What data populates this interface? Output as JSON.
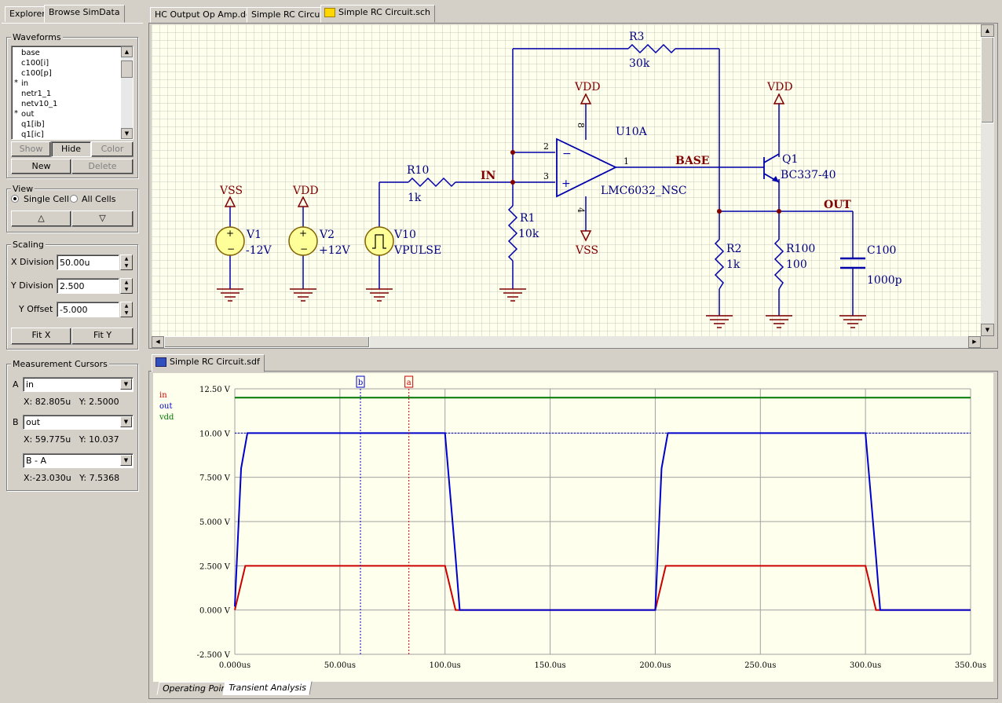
{
  "left_tabs": [
    "Explorer",
    "Browse SimData"
  ],
  "waveforms": {
    "title": "Waveforms",
    "items": [
      {
        "label": "base",
        "star": ""
      },
      {
        "label": "c100[i]",
        "star": ""
      },
      {
        "label": "c100[p]",
        "star": ""
      },
      {
        "label": "in",
        "star": "*"
      },
      {
        "label": "netr1_1",
        "star": ""
      },
      {
        "label": "netv10_1",
        "star": ""
      },
      {
        "label": "out",
        "star": "*"
      },
      {
        "label": "q1[ib]",
        "star": ""
      },
      {
        "label": "q1[ic]",
        "star": ""
      }
    ],
    "show_label": "Show",
    "hide_label": "Hide",
    "color_label": "Color",
    "new_label": "New",
    "delete_label": "Delete"
  },
  "view": {
    "title": "View",
    "single_cell": "Single Cell",
    "all_cells": "All Cells",
    "up_glyph": "△",
    "down_glyph": "▽"
  },
  "scaling": {
    "title": "Scaling",
    "x_label": "X Division",
    "x_value": "50.00u",
    "y_label": "Y Division",
    "y_value": "2.500",
    "offset_label": "Y Offset",
    "offset_value": "-5.000",
    "fit_x": "Fit X",
    "fit_y": "Fit Y"
  },
  "cursors": {
    "title": "Measurement Cursors",
    "a_label": "A",
    "a_value": "in",
    "a_readout": "X: 82.805u   Y: 2.5000",
    "b_label": "B",
    "b_value": "out",
    "b_readout": "X: 59.775u   Y: 10.037",
    "diff_value": "B - A",
    "diff_readout": "X:-23.030u   Y: 7.5368"
  },
  "doc_tabs": [
    "HC Output Op Amp.ddb",
    "Simple RC Circuit",
    "Simple RC Circuit.sch"
  ],
  "schematic": {
    "VSS_a": "VSS",
    "VDD_a": "VDD",
    "VDD_op": "VDD",
    "VSS_op": "VSS",
    "VDD_q": "VDD",
    "V1": "V1",
    "V1_val": "-12V",
    "V2": "V2",
    "V2_val": "+12V",
    "V10": "V10",
    "V10_val": "VPULSE",
    "R10": "R10",
    "R10_val": "1k",
    "R1": "R1",
    "R1_val": "10k",
    "R3": "R3",
    "R3_val": "30k",
    "U10A": "U10A",
    "U10A_val": "LMC6032_NSC",
    "pin2": "2",
    "pin3": "3",
    "pin1": "1",
    "pin8": "8",
    "pin4": "4",
    "net_in": "IN",
    "net_base": "BASE",
    "net_out": "OUT",
    "Q1": "Q1",
    "Q1_val": "BC337-40",
    "R2": "R2",
    "R2_val": "1k",
    "R100": "R100",
    "R100_val": "100",
    "C100": "C100",
    "C100_val": "1000p"
  },
  "sim_tab": "Simple RC Circuit.sdf",
  "bottom_tabs": [
    "Operating Point",
    "Transient Analysis"
  ],
  "colors": {
    "in": "#cc0000",
    "out": "#0000cc",
    "vdd": "#007700",
    "wire": "#0000aa",
    "comp": "#000080",
    "label": "#800000",
    "plot_bg": "#ffffee"
  },
  "chart_data": {
    "type": "line",
    "legend_position": "top-left",
    "grid": true,
    "xlim": [
      0,
      350
    ],
    "ylim": [
      -2.5,
      12.5
    ],
    "x_ticks": [
      "0.000us",
      "50.00us",
      "100.0us",
      "150.0us",
      "200.0us",
      "250.0us",
      "300.0us",
      "350.0us"
    ],
    "y_ticks": [
      "12.50 V",
      "10.00 V",
      "7.500 V",
      "5.000 V",
      "2.500 V",
      "0.000 V",
      "-2.500 V"
    ],
    "cursor_b": {
      "label": "b",
      "x": 59.775
    },
    "cursor_a": {
      "label": "a",
      "x": 82.805
    },
    "series": [
      {
        "name": "in",
        "color": "#cc0000",
        "points": [
          [
            0,
            0
          ],
          [
            5,
            2.5
          ],
          [
            100,
            2.5
          ],
          [
            105,
            0
          ],
          [
            200,
            0
          ],
          [
            205,
            2.5
          ],
          [
            300,
            2.5
          ],
          [
            305,
            0
          ],
          [
            350,
            0
          ]
        ]
      },
      {
        "name": "out",
        "color": "#0000cc",
        "points": [
          [
            0,
            0.2
          ],
          [
            3,
            8
          ],
          [
            6,
            10
          ],
          [
            100,
            10
          ],
          [
            105,
            3
          ],
          [
            107,
            0
          ],
          [
            200,
            0
          ],
          [
            203,
            8
          ],
          [
            206,
            10
          ],
          [
            300,
            10
          ],
          [
            305,
            3
          ],
          [
            307,
            0
          ],
          [
            350,
            0
          ]
        ]
      },
      {
        "name": "vdd",
        "color": "#007700",
        "points": [
          [
            0,
            12
          ],
          [
            350,
            12
          ]
        ]
      }
    ]
  }
}
